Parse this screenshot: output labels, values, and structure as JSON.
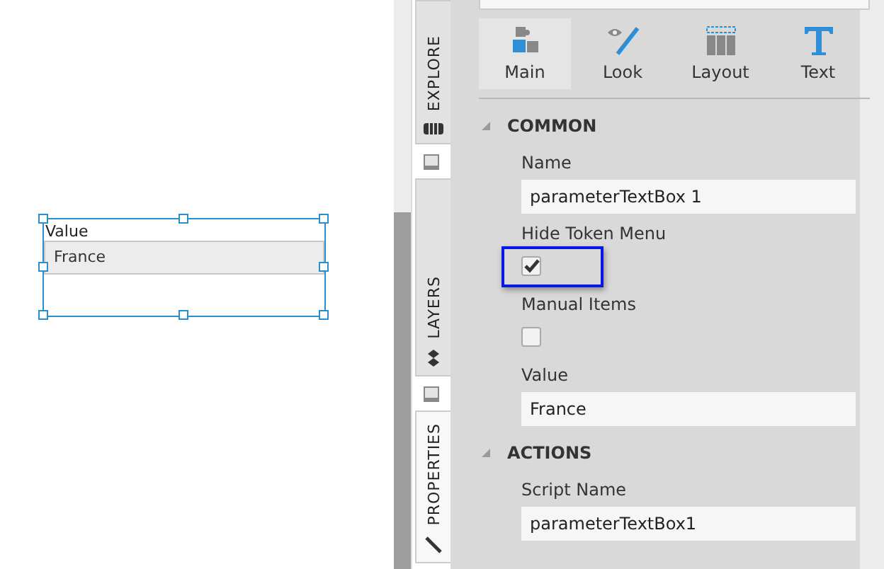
{
  "canvas": {
    "widget": {
      "label": "Value",
      "value": "France",
      "selected": true
    }
  },
  "side_tabs": [
    {
      "label": "EXPLORE",
      "selected": false
    },
    {
      "label": "LAYERS",
      "selected": false
    },
    {
      "label": "PROPERTIES",
      "selected": true
    }
  ],
  "toolbar": [
    {
      "label": "Main",
      "selected": true
    },
    {
      "label": "Look",
      "selected": false
    },
    {
      "label": "Layout",
      "selected": false
    },
    {
      "label": "Text",
      "selected": false
    }
  ],
  "sections": [
    {
      "title": "COMMON",
      "expanded": true,
      "fields": [
        {
          "kind": "text",
          "label": "Name",
          "value": "parameterTextBox 1",
          "highlighted": false
        },
        {
          "kind": "checkbox",
          "label": "Hide Token Menu",
          "checked": true,
          "highlighted": true
        },
        {
          "kind": "checkbox",
          "label": "Manual Items",
          "checked": false,
          "highlighted": false
        },
        {
          "kind": "text",
          "label": "Value",
          "value": "France",
          "highlighted": false
        }
      ]
    },
    {
      "title": "ACTIONS",
      "expanded": true,
      "fields": [
        {
          "kind": "text",
          "label": "Script Name",
          "value": "parameterTextBox1",
          "highlighted": false
        }
      ]
    }
  ]
}
